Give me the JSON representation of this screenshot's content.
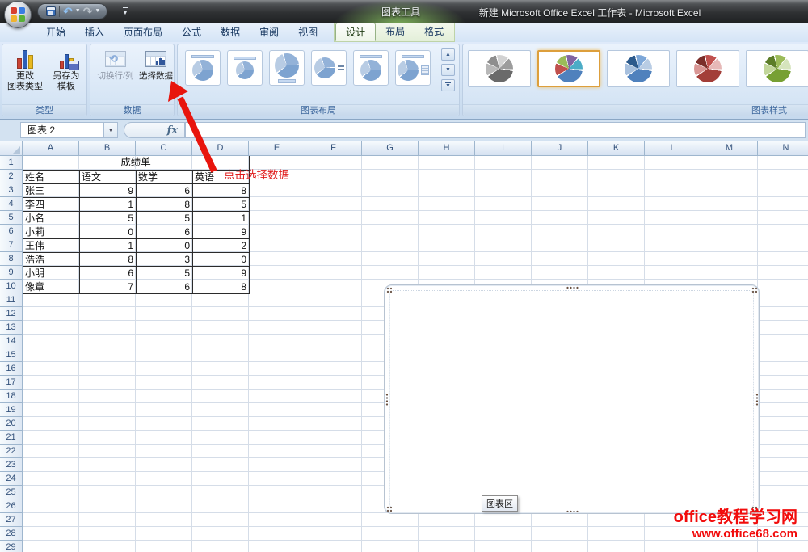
{
  "window": {
    "title": "新建 Microsoft Office Excel 工作表 - Microsoft Excel",
    "contextual_tool": "图表工具",
    "qat": {
      "save": "保存",
      "undo": "撤消",
      "redo": "恢复",
      "customize": "自定义快速访问工具栏"
    }
  },
  "ribbon": {
    "tabs": [
      {
        "label": "开始"
      },
      {
        "label": "插入"
      },
      {
        "label": "页面布局"
      },
      {
        "label": "公式"
      },
      {
        "label": "数据"
      },
      {
        "label": "审阅"
      },
      {
        "label": "视图"
      },
      {
        "label": "设计",
        "active": true,
        "contextual": true
      },
      {
        "label": "布局",
        "contextual": true
      },
      {
        "label": "格式",
        "contextual": true
      }
    ],
    "groups": {
      "type": {
        "label": "类型",
        "buttons": [
          {
            "line1": "更改",
            "line2": "图表类型"
          },
          {
            "line1": "另存为",
            "line2": "模板"
          }
        ]
      },
      "data": {
        "label": "数据",
        "buttons": [
          {
            "label": "切换行/列",
            "disabled": true
          },
          {
            "label": "选择数据",
            "disabled": false
          }
        ]
      },
      "layouts": {
        "label": "图表布局",
        "thumbnail_count": 6
      },
      "styles": {
        "label": "图表样式",
        "items": [
          {
            "colors": [
              "#6a6a6a",
              "#b8b8b8",
              "#8e8e8e",
              "#d2d2d2",
              "#9c9c9c"
            ],
            "selected": false
          },
          {
            "colors": [
              "#4f81bd",
              "#c0504d",
              "#9bbb59",
              "#8064a2",
              "#4bacc6"
            ],
            "selected": true
          },
          {
            "colors": [
              "#4f81bd",
              "#a7c0de",
              "#2c5a8c",
              "#7da7d8",
              "#b8cce4"
            ],
            "selected": false
          },
          {
            "colors": [
              "#a33e38",
              "#d99694",
              "#7b2e2a",
              "#c0504d",
              "#e6b8b7"
            ],
            "selected": false
          },
          {
            "colors": [
              "#77a033",
              "#c2d69a",
              "#5c7d28",
              "#9bbb59",
              "#d6e4bd"
            ],
            "selected": false
          }
        ]
      }
    }
  },
  "formula_bar": {
    "name_box": "图表 2",
    "fx_label": "fx",
    "formula_value": ""
  },
  "grid": {
    "columns": [
      "A",
      "B",
      "C",
      "D",
      "E",
      "F",
      "G",
      "H",
      "I",
      "J",
      "K",
      "L",
      "M",
      "N"
    ],
    "row_count": 29
  },
  "sheet_table": {
    "title": "成绩单",
    "headers": [
      "姓名",
      "语文",
      "数学",
      "英语"
    ],
    "rows": [
      [
        "张三",
        "9",
        "6",
        "8"
      ],
      [
        "李四",
        "1",
        "8",
        "5"
      ],
      [
        "小名",
        "5",
        "5",
        "1"
      ],
      [
        "小莉",
        "0",
        "6",
        "9"
      ],
      [
        "王伟",
        "1",
        "0",
        "2"
      ],
      [
        "浩浩",
        "8",
        "3",
        "0"
      ],
      [
        "小明",
        "6",
        "5",
        "9"
      ],
      [
        "像章",
        "7",
        "6",
        "8"
      ]
    ]
  },
  "annotation": {
    "text": "点击选择数据"
  },
  "chart": {
    "tooltip": "图表区"
  },
  "watermark": {
    "line1": "office教程学习网",
    "line2": "www.office68.com"
  },
  "colors": {
    "arrow_red": "#e8150d",
    "annotation_red": "#e01b1b",
    "watermark_red": "#f10c0c",
    "selected_style_border": "#dd9f3c"
  }
}
